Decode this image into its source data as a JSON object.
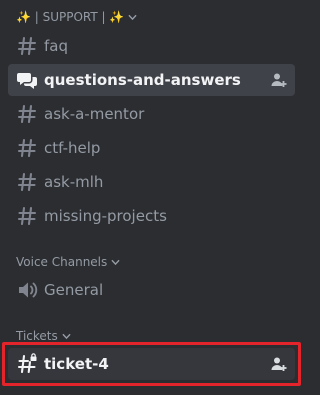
{
  "category_support": {
    "label": "✨ | SUPPORT | ✨"
  },
  "channels_support": [
    {
      "name": "faq",
      "icon": "hash-icon"
    },
    {
      "name": "questions-and-answers",
      "icon": "forum-icon"
    },
    {
      "name": "ask-a-mentor",
      "icon": "hash-icon"
    },
    {
      "name": "ctf-help",
      "icon": "hash-icon"
    },
    {
      "name": "ask-mlh",
      "icon": "hash-icon"
    },
    {
      "name": "missing-projects",
      "icon": "hash-icon"
    }
  ],
  "category_voice": {
    "label": "Voice Channels"
  },
  "channels_voice": [
    {
      "name": "General",
      "icon": "speaker-icon"
    }
  ],
  "category_tickets": {
    "label": "Tickets"
  },
  "channels_tickets": [
    {
      "name": "ticket-4",
      "icon": "private-hash-icon"
    }
  ],
  "colors": {
    "background": "#2b2d31",
    "muted_text": "#949ba4",
    "active_text": "#f2f3f5",
    "highlight_border": "#e3242b"
  }
}
